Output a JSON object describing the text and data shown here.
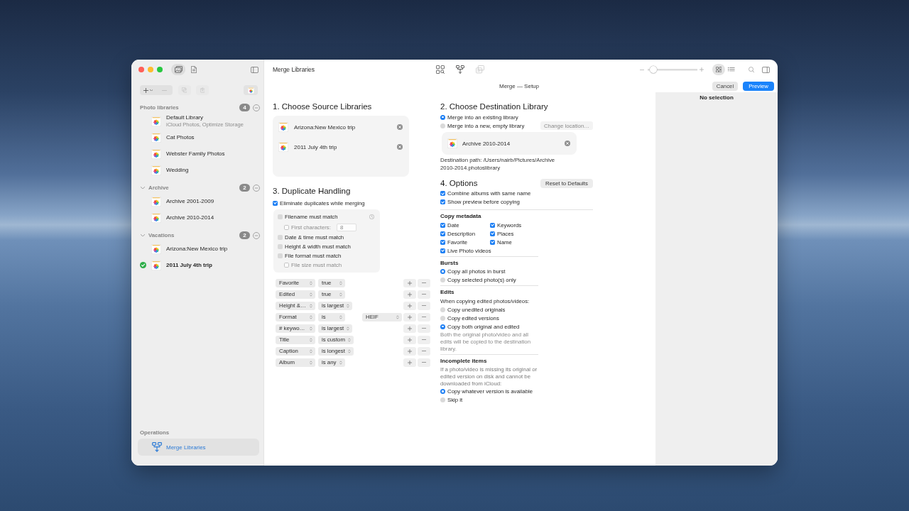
{
  "window": {
    "title": "Merge Libraries",
    "subtitle": "Merge — Setup"
  },
  "sidebar": {
    "view_tabs": [
      {
        "kind": "library",
        "selected": true
      },
      {
        "kind": "document",
        "selected": false
      }
    ],
    "tools": [
      {
        "kind": "add",
        "disabled": false
      },
      {
        "kind": "remove",
        "disabled": true
      },
      {
        "kind": "duplicate",
        "disabled": true
      },
      {
        "kind": "import",
        "disabled": true
      }
    ],
    "sections": [
      {
        "kind": "group",
        "title": "Photo libraries",
        "count": "4",
        "items": [
          {
            "name": "Default Library",
            "detail": "iCloud Photos, Optimize Storage",
            "active": false
          },
          {
            "name": "Cat Photos",
            "active": false
          },
          {
            "name": "Webster Family Photos",
            "active": false
          },
          {
            "name": "Wedding",
            "active": false
          }
        ]
      },
      {
        "kind": "folder",
        "title": "Archive",
        "count": "2",
        "expanded": true,
        "items": [
          {
            "name": "Archive 2001-2009",
            "active": false
          },
          {
            "name": "Archive 2010-2014",
            "active": false
          }
        ]
      },
      {
        "kind": "folder",
        "title": "Vacations",
        "count": "2",
        "expanded": true,
        "items": [
          {
            "name": "Arizona:New Mexico trip",
            "active": false
          },
          {
            "name": "2011 July 4th trip",
            "active": true
          }
        ]
      }
    ],
    "operations": {
      "title": "Operations",
      "items": [
        {
          "label": "Merge Libraries",
          "selected": true
        }
      ]
    }
  },
  "toolbar": {
    "tools": [
      {
        "kind": "browse",
        "disabled": false
      },
      {
        "kind": "merge",
        "disabled": false
      },
      {
        "kind": "compare",
        "disabled": true
      }
    ],
    "zoom": {
      "level": 0.05
    },
    "view_modes": [
      {
        "kind": "grid",
        "selected": true
      },
      {
        "kind": "list",
        "selected": false
      }
    ]
  },
  "actions": [
    {
      "kind": "cancel",
      "label": "Cancel"
    },
    {
      "kind": "preview",
      "label": "Preview"
    }
  ],
  "source": {
    "title": "1. Choose Source Libraries",
    "libraries": [
      {
        "name": "Arizona:New Mexico trip"
      },
      {
        "name": "2011 July 4th trip"
      }
    ]
  },
  "destination": {
    "title": "2. Choose Destination Library",
    "options": [
      {
        "label": "Merge into an existing library",
        "selected": true
      },
      {
        "label": "Merge into a new, empty library",
        "selected": false,
        "button": {
          "label": "Change location…",
          "disabled": true
        }
      }
    ],
    "library": {
      "name": "Archive 2010-2014"
    },
    "path": "Destination path: /Users/nairb/Pictures/Archive 2010-2014.photoslibrary"
  },
  "duplicates": {
    "title": "3. Duplicate Handling",
    "eliminate": {
      "label": "Eliminate duplicates while merging",
      "checked": true
    },
    "criteria": [
      {
        "label": "Filename must match",
        "checked": false,
        "disabled": false,
        "help": true,
        "children": [
          {
            "label": "First characters:",
            "checked": false,
            "disabled": true,
            "value": "8"
          }
        ]
      },
      {
        "label": "Date & time must match",
        "checked": false,
        "disabled": false
      },
      {
        "label": "Height & width must match",
        "checked": false,
        "disabled": false
      },
      {
        "label": "File format must match",
        "checked": false,
        "disabled": false,
        "children": [
          {
            "label": "File size must match",
            "checked": false,
            "disabled": true
          }
        ]
      }
    ],
    "rules": [
      {
        "attribute": "Favorite",
        "condition": "true"
      },
      {
        "attribute": "Edited",
        "condition": "true"
      },
      {
        "attribute": "Height &…",
        "condition": "is largest"
      },
      {
        "attribute": "Format",
        "condition": "is",
        "value": "HEIF"
      },
      {
        "attribute": "# keywo…",
        "condition": "is largest"
      },
      {
        "attribute": "Title",
        "condition": "is custom"
      },
      {
        "attribute": "Caption",
        "condition": "is longest"
      },
      {
        "attribute": "Album",
        "condition": "is any"
      }
    ]
  },
  "options": {
    "title": "4. Options",
    "reset": "Reset to Defaults",
    "general": [
      {
        "label": "Combine albums with same name",
        "checked": true
      },
      {
        "label": "Show preview before copying",
        "checked": true
      }
    ],
    "sections": [
      {
        "title": "Copy metadata",
        "kind": "grid",
        "content": [
          {
            "kind": "checkbox",
            "label": "Date",
            "checked": true
          },
          {
            "kind": "checkbox",
            "label": "Keywords",
            "checked": true
          },
          {
            "kind": "checkbox",
            "label": "Description",
            "checked": true
          },
          {
            "kind": "checkbox",
            "label": "Places",
            "checked": true
          },
          {
            "kind": "checkbox",
            "label": "Favorite",
            "checked": true
          },
          {
            "kind": "checkbox",
            "label": "Name",
            "checked": true
          },
          {
            "kind": "checkbox",
            "label": "Live Photo videos",
            "checked": true
          }
        ]
      },
      {
        "title": "Bursts",
        "kind": "stack",
        "content": [
          {
            "kind": "radio",
            "label": "Copy all photos in burst",
            "selected": true
          },
          {
            "kind": "radio",
            "label": "Copy selected photo(s) only",
            "selected": false
          }
        ]
      },
      {
        "title": "Edits",
        "kind": "stack",
        "content": [
          {
            "kind": "label",
            "text": "When copying edited photos/videos:"
          },
          {
            "kind": "radio",
            "label": "Copy unedited originals",
            "selected": false
          },
          {
            "kind": "radio",
            "label": "Copy edited versions",
            "selected": false
          },
          {
            "kind": "radio",
            "label": "Copy both original and edited",
            "selected": true
          },
          {
            "kind": "note",
            "text": "Both the original photo/video and all edits will be copied to the destination library."
          }
        ]
      },
      {
        "title": "Incomplete items",
        "kind": "stack",
        "content": [
          {
            "kind": "hint",
            "text": "If a photo/video is missing its original or edited version on disk and cannot be downloaded from iCloud:"
          },
          {
            "kind": "radio",
            "label": "Copy whatever version is available",
            "selected": true
          },
          {
            "kind": "radio",
            "label": "Skip it",
            "selected": false
          }
        ]
      }
    ]
  },
  "inspector": {
    "message": "No selection"
  }
}
